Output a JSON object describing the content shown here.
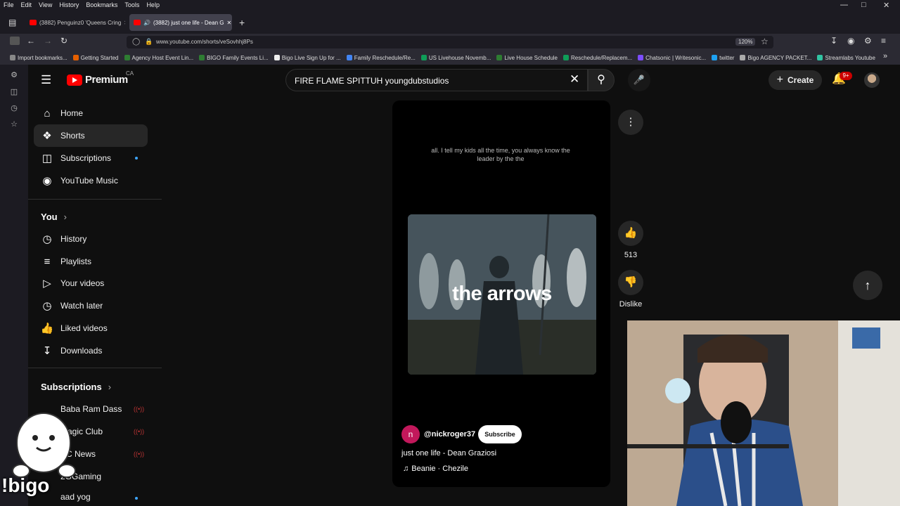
{
  "browser": {
    "menu": [
      "File",
      "Edit",
      "View",
      "History",
      "Bookmarks",
      "Tools",
      "Help"
    ],
    "tabs": [
      {
        "label": "(3882) Penguinz0 'Queens Cring"
      },
      {
        "label": "(3882) just one life - Dean G"
      }
    ],
    "url": "www.youtube.com/shorts/veSovhhj8Ps",
    "zoom": "120%",
    "bookmarks": [
      "Import bookmarks...",
      "Getting Started",
      "Agency Host Event Lin...",
      "BIGO Family Events Li...",
      "Bigo Live Sign Up for ...",
      "Family Reschedule/Re...",
      "US Livehouse Novemb...",
      "Live House Schedule",
      "Reschedule/Replacem...",
      "Chatsonic | Writesonic...",
      "twitter",
      "Bigo AGENCY PACKET...",
      "Streamlabs Youtube"
    ]
  },
  "youtube": {
    "logo": "Premium",
    "region": "CA",
    "search_value": "FIRE FLAME SPITTUH youngdubstudios",
    "create_label": "Create",
    "notif_badge": "9+",
    "nav": [
      {
        "label": "Home",
        "icon": "home-icon"
      },
      {
        "label": "Shorts",
        "icon": "shorts-icon"
      },
      {
        "label": "Subscriptions",
        "icon": "subscriptions-icon"
      },
      {
        "label": "YouTube Music",
        "icon": "youtube-music-icon"
      }
    ],
    "you_title": "You",
    "you_items": [
      {
        "label": "History",
        "icon": "history-icon"
      },
      {
        "label": "Playlists",
        "icon": "playlists-icon"
      },
      {
        "label": "Your videos",
        "icon": "your-videos-icon"
      },
      {
        "label": "Watch later",
        "icon": "watch-later-icon"
      },
      {
        "label": "Liked videos",
        "icon": "liked-videos-icon"
      },
      {
        "label": "Downloads",
        "icon": "downloads-icon"
      }
    ],
    "subs_title": "Subscriptions",
    "subscriptions": [
      "Baba Ram Dass",
      "Magic Club",
      "BC News",
      "2GGaming",
      "aad yog"
    ]
  },
  "short": {
    "caption": "all. I tell my kids all the time, you always know the leader by the the",
    "overlay_text": "the arrows",
    "channel_initial": "n",
    "channel": "@nickroger37",
    "subscribe_label": "Subscribe",
    "title": "just one life - Dean Graziosi",
    "music": "Beanie · Chezile",
    "likes": "513",
    "dislike_label": "Dislike"
  },
  "overlay": {
    "bigo_text": "!bigo"
  }
}
